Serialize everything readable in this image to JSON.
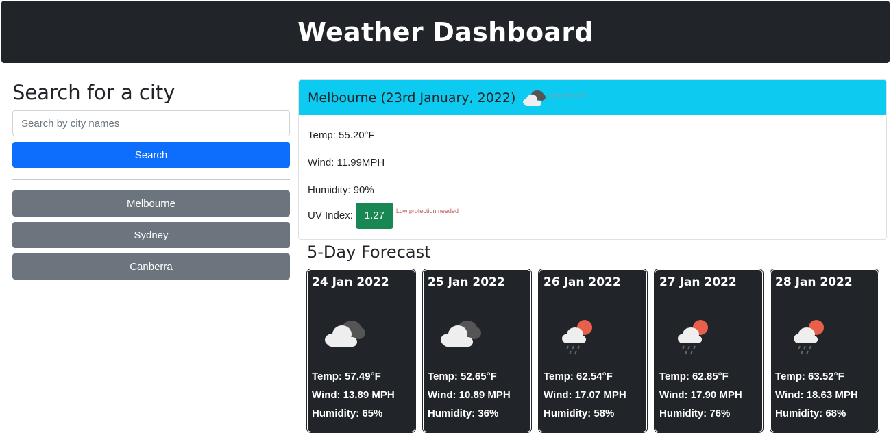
{
  "header": {
    "title": "Weather Dashboard"
  },
  "search": {
    "heading": "Search for a city",
    "placeholder": "Search by city names",
    "button_label": "Search"
  },
  "history": [
    {
      "label": "Melbourne"
    },
    {
      "label": "Sydney"
    },
    {
      "label": "Canberra"
    }
  ],
  "current": {
    "title": "Melbourne (23rd January, 2022)",
    "icon": "overcast-clouds-icon",
    "description": "overcast clouds",
    "temp": "Temp: 55.20°F",
    "wind": "Wind: 11.99MPH",
    "humidity": "Humidity: 90%",
    "uv_label": "UV Index:",
    "uv_value": "1.27",
    "uv_note": "Low protection needed",
    "uv_color": "#198754",
    "header_color": "#0dcaf0"
  },
  "forecast": {
    "title": "5-Day Forecast",
    "days": [
      {
        "date": "24 Jan 2022",
        "icon": "overcast-clouds-icon",
        "temp": "Temp: 57.49°F",
        "wind": "Wind: 13.89 MPH",
        "humidity": "Humidity: 65%"
      },
      {
        "date": "25 Jan 2022",
        "icon": "overcast-clouds-icon",
        "temp": "Temp: 52.65°F",
        "wind": "Wind: 10.89 MPH",
        "humidity": "Humidity: 36%"
      },
      {
        "date": "26 Jan 2022",
        "icon": "sun-rain-cloud-icon",
        "temp": "Temp: 62.54°F",
        "wind": "Wind: 17.07 MPH",
        "humidity": "Humidity: 58%"
      },
      {
        "date": "27 Jan 2022",
        "icon": "sun-rain-cloud-icon",
        "temp": "Temp: 62.85°F",
        "wind": "Wind: 17.90 MPH",
        "humidity": "Humidity: 76%"
      },
      {
        "date": "28 Jan 2022",
        "icon": "sun-rain-cloud-icon",
        "temp": "Temp: 63.52°F",
        "wind": "Wind: 18.63 MPH",
        "humidity": "Humidity: 68%"
      }
    ]
  }
}
